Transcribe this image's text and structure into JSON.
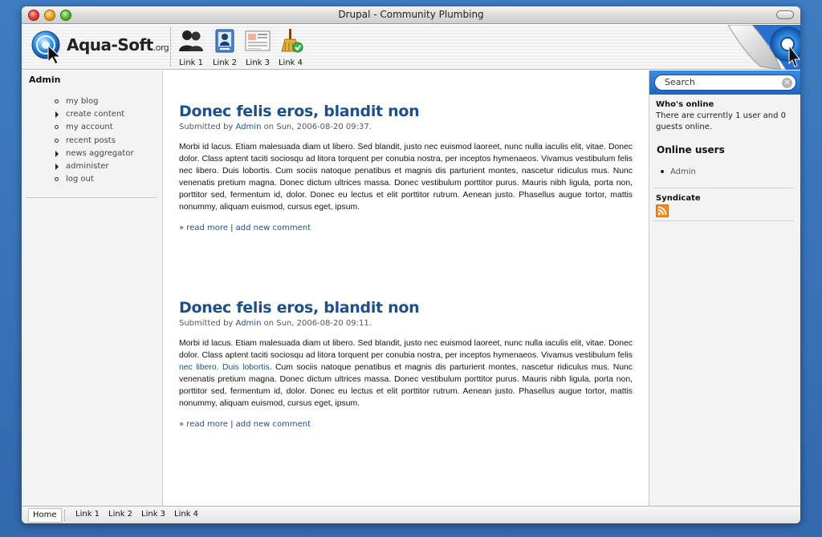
{
  "window": {
    "title": "Drupal - Community Plumbing"
  },
  "header": {
    "logo_text": "Aqua-Soft",
    "logo_suffix": ".org",
    "nav": [
      {
        "label": "Link 1",
        "icon": "users-icon"
      },
      {
        "label": "Link 2",
        "icon": "id-card-icon"
      },
      {
        "label": "Link 3",
        "icon": "document-icon"
      },
      {
        "label": "Link 4",
        "icon": "broom-check-icon"
      }
    ]
  },
  "sidebar_left": {
    "title": "Admin",
    "items": [
      {
        "label": "my blog",
        "bullet": "circle"
      },
      {
        "label": "create content",
        "bullet": "triangle"
      },
      {
        "label": "my account",
        "bullet": "circle"
      },
      {
        "label": "recent posts",
        "bullet": "circle"
      },
      {
        "label": "news aggregator",
        "bullet": "triangle"
      },
      {
        "label": "administer",
        "bullet": "triangle"
      },
      {
        "label": "log out",
        "bullet": "circle"
      }
    ]
  },
  "posts": [
    {
      "title": "Donec felis eros, blandit non",
      "meta_prefix": "Submitted by",
      "author": "Admin",
      "meta_suffix": "on Sun, 2006-08-20 09:37.",
      "body": "Morbi id lacus. Etiam malesuada diam ut libero. Sed blandit, justo nec euismod laoreet, nunc nulla iaculis elit, vitae. Donec dolor. Class aptent taciti sociosqu ad litora torquent per conubia nostra, per inceptos hymenaeos. Vivamus vestibulum felis nec libero. Duis lobortis. Cum sociis natoque penatibus et magnis dis parturient montes, nascetur ridiculus mus. Nunc venenatis pretium magna. Donec dictum ultrices massa. Donec vestibulum porttitor purus. Mauris nibh ligula, porta non, porttitor sed, fermentum id, dolor. Donec eu lectus et elit porttitor rutrum. Aenean justo. Phasellus augue tortor, mattis nonummy, aliquam euismod, cursus eget, ipsum.",
      "read_more": "read more",
      "separator": "|",
      "add_comment": "add new comment"
    },
    {
      "title": "Donec felis eros, blandit non",
      "meta_prefix": "Submitted by",
      "author": "Admin",
      "meta_suffix": "on Sun, 2006-08-20 09:11.",
      "body_before": "Morbi id lacus. Etiam malesuada diam ut libero. Sed blandit, justo nec euismod laoreet, nunc nulla iaculis elit, vitae. Donec dolor. Class aptent taciti sociosqu ad litora torquent per conubia nostra, per inceptos hymenaeos. Vivamus vestibulum felis ",
      "body_link": "nec libero. Duis lobortis",
      "body_after": ". Cum sociis natoque penatibus et magnis dis parturient montes, nascetur ridiculus mus. Nunc venenatis pretium magna. Donec dictum ultrices massa. Donec vestibulum porttitor purus. Mauris nibh ligula, porta non, porttitor sed, fermentum id, dolor. Donec eu lectus et elit porttitor rutrum. Aenean justo. Phasellus augue tortor, mattis nonummy, aliquam euismod, cursus eget, ipsum.",
      "read_more": "read more",
      "separator": "|",
      "add_comment": "add new comment"
    }
  ],
  "sidebar_right": {
    "search_placeholder": "Search",
    "whos_online_title": "Who's online",
    "whos_online_text": "There are currently 1 user and 0 guests online.",
    "online_users_title": "Online users",
    "online_users": [
      "Admin"
    ],
    "syndicate_title": "Syndicate",
    "syndicate_icon": "rss-icon"
  },
  "footer": {
    "home": "Home",
    "links": [
      "Link 1",
      "Link 2",
      "Link 3",
      "Link 4"
    ]
  },
  "colors": {
    "desktop": "#3a73b8",
    "link": "#1d4f8c",
    "search_bar": "#2a78d4"
  }
}
